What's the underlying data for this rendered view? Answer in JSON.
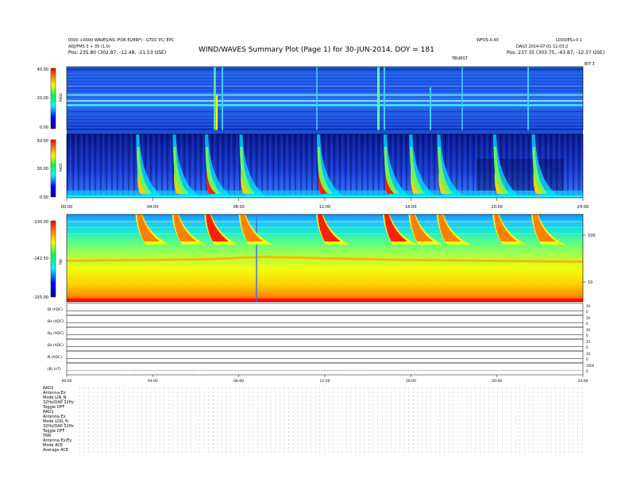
{
  "header": {
    "title": "WIND/WAVES Summary Plot (Page 1) for 30-JUN-2014, DOY = 181",
    "left_line1": "0000 +0000 WAVES/NS (FOR ELMRF) - GTOC PC/ EPC",
    "left_line2": "ADJ/FMS 3 + 35 (1.0)",
    "left_line3": "Pos: 235.80 (302.87, -12.48, -11.53 GSE)",
    "right_top1": "WFDS-0.40",
    "right_top2": "LDOOPS+0.1",
    "right_line2": "DAILY 2014-07-01 11:03:2",
    "right_line3": "Pos: 237.35 (303.75, -43.87, -12.37 GSE)",
    "cm_label": "TBURST",
    "ch_label": "BIT 3"
  },
  "chart_data": [
    {
      "type": "heatmap",
      "panel": "RAD2",
      "ylabel": "RAD2",
      "colorbar_ticks": [
        "40.00",
        "20.00",
        "0.00"
      ],
      "colorscale": [
        "#0000a0",
        "#0000ff",
        "#00ffff",
        "#00ff00",
        "#ffff00",
        "#ff8000",
        "#ff0000"
      ],
      "xlim": [
        0,
        24
      ]
    },
    {
      "type": "heatmap",
      "panel": "RAD1",
      "ylabel": "RAD1",
      "colorbar_ticks": [
        "50.00",
        "30.00",
        "0.00"
      ],
      "xlim": [
        0,
        24
      ],
      "x_ticks": [
        "00:00",
        "04:00",
        "08:00",
        "12:00",
        "16:00",
        "20:00",
        "24:00"
      ],
      "type_iii_bursts_hours": [
        3.3,
        5.0,
        6.5,
        8.1,
        11.7,
        14.8,
        16.0,
        17.3,
        19.9,
        21.7
      ]
    },
    {
      "type": "heatmap",
      "panel": "TNR",
      "ylabel": "TNR",
      "colorbar_ticks": [
        "-130.00",
        "-142.50",
        "-155.00"
      ],
      "right_axis_ticks": [
        "100",
        "10"
      ],
      "xlim": [
        0,
        24
      ]
    },
    {
      "type": "line",
      "panel": "housekeeping",
      "x_ticks": [
        "00:00",
        "04:00",
        "08:00",
        "12:00",
        "16:00",
        "20:00",
        "24:00"
      ],
      "series": [
        {
          "name": "Bl (ADC)",
          "right_ticks": [
            "20",
            "0"
          ]
        },
        {
          "name": "Bx (ADC)",
          "right_ticks": [
            "20",
            "0"
          ]
        },
        {
          "name": "By (ADC)",
          "right_ticks": [
            "20",
            "0"
          ]
        },
        {
          "name": "Bz (ADC)",
          "right_ticks": [
            "20",
            "0"
          ]
        },
        {
          "name": "N (ADC)",
          "right_ticks": [
            "20",
            "0"
          ]
        },
        {
          "name": "|B| (nT)",
          "right_ticks": [
            "1000",
            "0"
          ]
        }
      ]
    }
  ],
  "footer": {
    "rad2_block": [
      "RAD2",
      "Antenna    Ex",
      "Mode    LIN_N",
      "32Hz/DAP  32Hz",
      "Toggle    OFF"
    ],
    "rad1_block": [
      "RAD1",
      "Antenna    Ex",
      "Mode   LOG_N",
      "32Hz/DAP 32Hz",
      "Toggle    OFF"
    ],
    "tnr_block": [
      "TNR",
      "Antenna    Ex/Ey",
      "Mode    ACE",
      "Average   ACE"
    ]
  }
}
